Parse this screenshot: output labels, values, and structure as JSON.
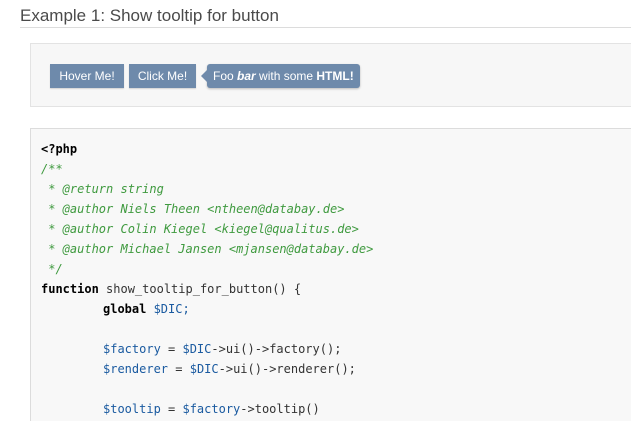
{
  "page": {
    "title": "Example 1: Show tooltip for button"
  },
  "demo": {
    "hover_button": "Hover Me!",
    "click_button": "Click Me!",
    "tooltip": {
      "prefix": "Foo ",
      "em": "bar",
      "middle": " with some ",
      "strong": "HTML!"
    },
    "colors": {
      "button_bg": "#6e8aab",
      "button_text": "#ffffff"
    }
  },
  "code": {
    "lines": [
      "<?php",
      "/**",
      " * @return string",
      " * @author Niels Theen <ntheen@databay.de>",
      " * @author Colin Kiegel <kiegel@qualitus.de>",
      " * @author Michael Jansen <mjansen@databay.de>",
      " */",
      "function",
      " show_tooltip_for_button() {",
      "global",
      " $DIC;",
      "$factory",
      " = ",
      "$DIC",
      "->ui()->factory();",
      "$renderer",
      " = ",
      "$DIC",
      "->ui()->renderer();",
      "$tooltip",
      " = ",
      "$factory",
      "->tooltip()"
    ],
    "colors": {
      "comment": "#3f9a3f",
      "variable": "#1a5aa0"
    }
  }
}
